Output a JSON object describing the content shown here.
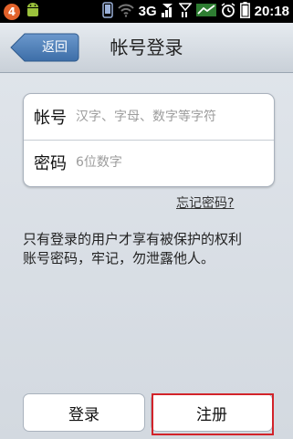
{
  "status_bar": {
    "notification_count": "4",
    "network_type": "3G",
    "time": "20:18",
    "icons": [
      "android-icon",
      "phone-icon",
      "wifi-icon",
      "signal-icon",
      "no-sim-icon",
      "data-activity-icon",
      "alarm-icon",
      "battery-icon"
    ]
  },
  "header": {
    "back_label": "返回",
    "title": "帐号登录"
  },
  "form": {
    "account_label": "帐号",
    "account_placeholder": "汉字、字母、数字等字符",
    "password_label": "密码",
    "password_placeholder": "6位数字"
  },
  "forgot_password": "忘记密码?",
  "notice": {
    "line1": "只有登录的用户才享有被保护的权利",
    "line2": "账号密码，牢记，勿泄露他人。"
  },
  "buttons": {
    "login": "登录",
    "register": "注册"
  },
  "colors": {
    "back_button": "#4f7fb5",
    "highlight": "#d2232a",
    "notification_badge": "#e2622a"
  }
}
